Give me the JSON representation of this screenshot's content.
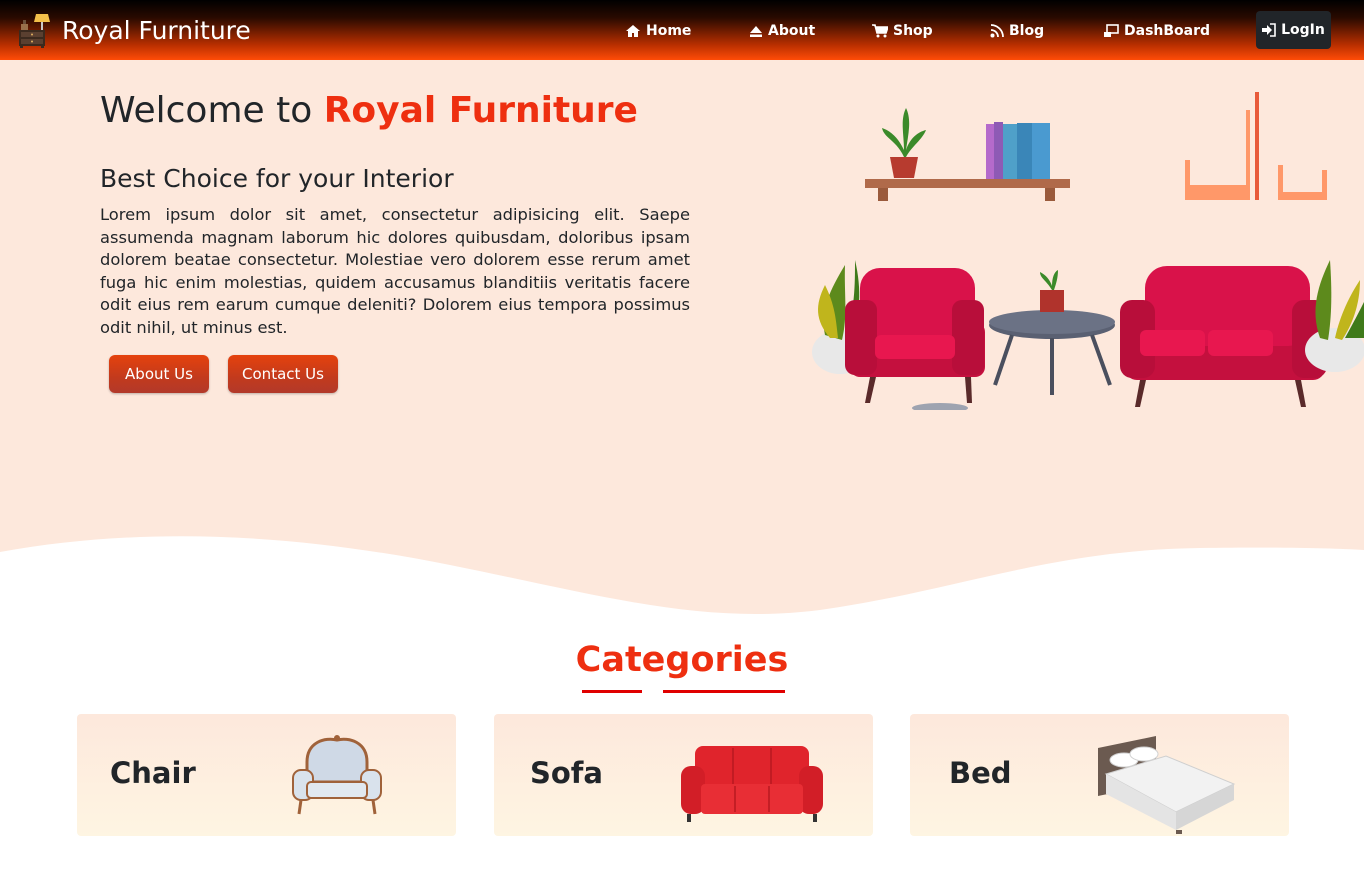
{
  "nav": {
    "brand": "Royal Furniture",
    "items": [
      {
        "label": "Home",
        "icon": "home-icon"
      },
      {
        "label": "About",
        "icon": "eject-icon"
      },
      {
        "label": "Shop",
        "icon": "cart-icon"
      },
      {
        "label": "Blog",
        "icon": "rss-icon"
      },
      {
        "label": "DashBoard",
        "icon": "dashboard-icon"
      }
    ],
    "login": "LogIn"
  },
  "hero": {
    "title_prefix": "Welcome to ",
    "title_accent": "Royal Furniture",
    "subtitle": "Best Choice for your Interior",
    "body": "Lorem ipsum dolor sit amet, consectetur adipisicing elit. Saepe assumenda magnam laborum hic dolores quibusdam, doloribus ipsam dolorem beatae consectetur. Molestiae vero dolorem esse rerum amet fuga hic enim molestias, quidem accusamus blanditiis veritatis facere odit eius rem earum cumque deleniti? Dolorem eius tempora possimus odit nihil, ut minus est.",
    "buttons": {
      "about": "About Us",
      "contact": "Contact Us"
    }
  },
  "categories": {
    "title": "Categories",
    "items": [
      {
        "label": "Chair"
      },
      {
        "label": "Sofa"
      },
      {
        "label": "Bed"
      }
    ]
  },
  "colors": {
    "accent": "#ee2f10",
    "hero_bg": "#fde8dc",
    "login_bg": "#212529",
    "button": "#d23d17"
  }
}
